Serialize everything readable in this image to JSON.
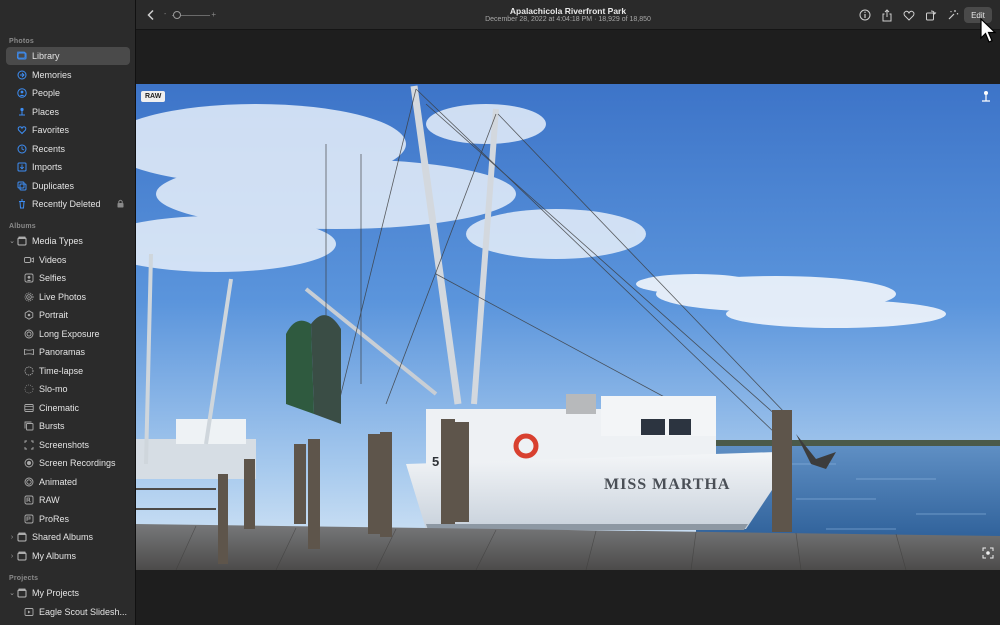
{
  "toolbar": {
    "title": "Apalachicola Riverfront Park",
    "subtitle": "December 28, 2022 at 4:04:18 PM  ·  18,929 of 18,850",
    "edit_label": "Edit"
  },
  "sidebar": {
    "photos_title": "Photos",
    "albums_title": "Albums",
    "projects_title": "Projects",
    "photos_items": [
      {
        "label": "Library",
        "icon": "library-icon"
      },
      {
        "label": "Memories",
        "icon": "memories-icon"
      },
      {
        "label": "People",
        "icon": "people-icon"
      },
      {
        "label": "Places",
        "icon": "places-icon"
      },
      {
        "label": "Favorites",
        "icon": "heart-icon"
      },
      {
        "label": "Recents",
        "icon": "clock-icon"
      },
      {
        "label": "Imports",
        "icon": "import-icon"
      },
      {
        "label": "Duplicates",
        "icon": "duplicates-icon"
      },
      {
        "label": "Recently Deleted",
        "icon": "trash-icon"
      }
    ],
    "media_types": {
      "label": "Media Types",
      "items": [
        {
          "label": "Videos",
          "icon": "video-icon"
        },
        {
          "label": "Selfies",
          "icon": "selfie-icon"
        },
        {
          "label": "Live Photos",
          "icon": "live-photo-icon"
        },
        {
          "label": "Portrait",
          "icon": "portrait-icon"
        },
        {
          "label": "Long Exposure",
          "icon": "long-exposure-icon"
        },
        {
          "label": "Panoramas",
          "icon": "panorama-icon"
        },
        {
          "label": "Time-lapse",
          "icon": "timelapse-icon"
        },
        {
          "label": "Slo-mo",
          "icon": "slomo-icon"
        },
        {
          "label": "Cinematic",
          "icon": "cinematic-icon"
        },
        {
          "label": "Bursts",
          "icon": "bursts-icon"
        },
        {
          "label": "Screenshots",
          "icon": "screenshot-icon"
        },
        {
          "label": "Screen Recordings",
          "icon": "screen-recording-icon"
        },
        {
          "label": "Animated",
          "icon": "animated-icon"
        },
        {
          "label": "RAW",
          "icon": "raw-icon"
        },
        {
          "label": "ProRes",
          "icon": "prores-icon"
        }
      ]
    },
    "shared_albums": "Shared Albums",
    "my_albums": "My Albums",
    "my_projects": "My Projects",
    "project_item": "Eagle Scout Slidesh..."
  },
  "photo": {
    "raw_badge": "RAW",
    "boat_name": "MISS MARTHA",
    "hull_number": "5 68"
  },
  "colors": {
    "accent": "#3d8ef5",
    "sidebar_bg": "#2b2b2b",
    "selected_bg": "#4a4a4a"
  }
}
